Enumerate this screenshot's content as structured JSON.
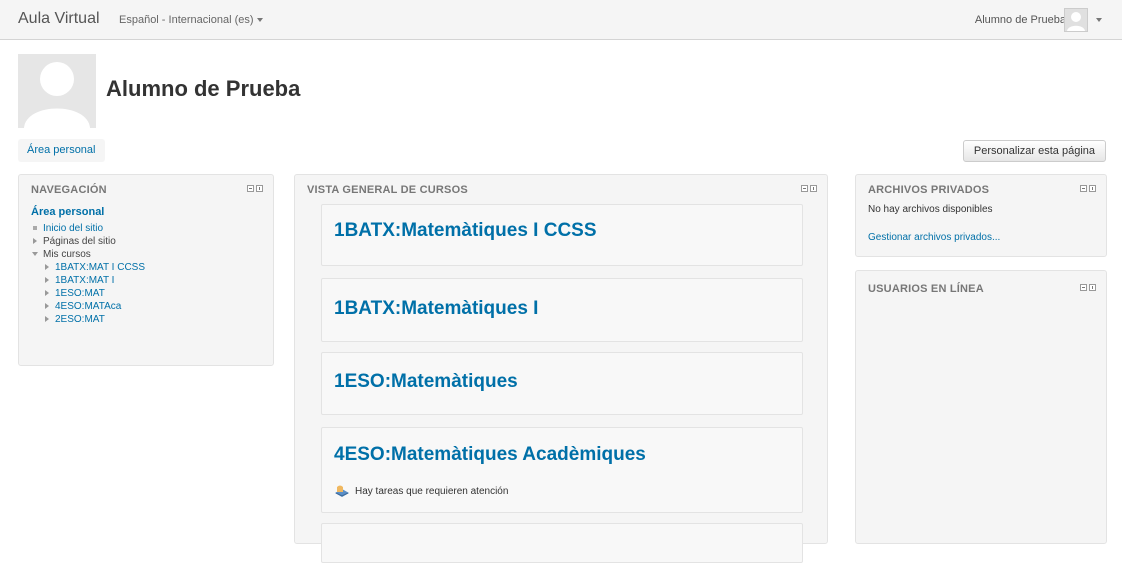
{
  "navbar": {
    "brand": "Aula Virtual",
    "language": "Español - Internacional (es)",
    "user_name": "Alumno de Prueba"
  },
  "header": {
    "title": "Alumno de Prueba",
    "breadcrumb": "Área personal",
    "customize_button": "Personalizar esta página"
  },
  "navigation": {
    "title": "NAVEGACIÓN",
    "root": "Área personal",
    "items": [
      {
        "label": "Inicio del sitio"
      },
      {
        "label": "Páginas del sitio"
      },
      {
        "label": "Mis cursos"
      }
    ],
    "courses": [
      "1BATX:MAT I CCSS",
      "1BATX:MAT I",
      "1ESO:MAT",
      "4ESO:MATAca",
      "2ESO:MAT"
    ]
  },
  "course_overview": {
    "title": "VISTA GENERAL DE CURSOS",
    "courses": [
      {
        "name": "1BATX:Matemàtiques I CCSS"
      },
      {
        "name": "1BATX:Matemàtiques I"
      },
      {
        "name": "1ESO:Matemàtiques"
      },
      {
        "name": "4ESO:Matemàtiques Acadèmiques",
        "alert": "Hay tareas que requieren atención"
      }
    ]
  },
  "private_files": {
    "title": "ARCHIVOS PRIVADOS",
    "empty_text": "No hay archivos disponibles",
    "manage_link": "Gestionar archivos privados..."
  },
  "online_users": {
    "title": "USUARIOS EN LÍNEA"
  },
  "colors": {
    "link": "#0070a8",
    "navbar_bg": "#f5f5f5",
    "block_bg": "#f5f5f5"
  }
}
